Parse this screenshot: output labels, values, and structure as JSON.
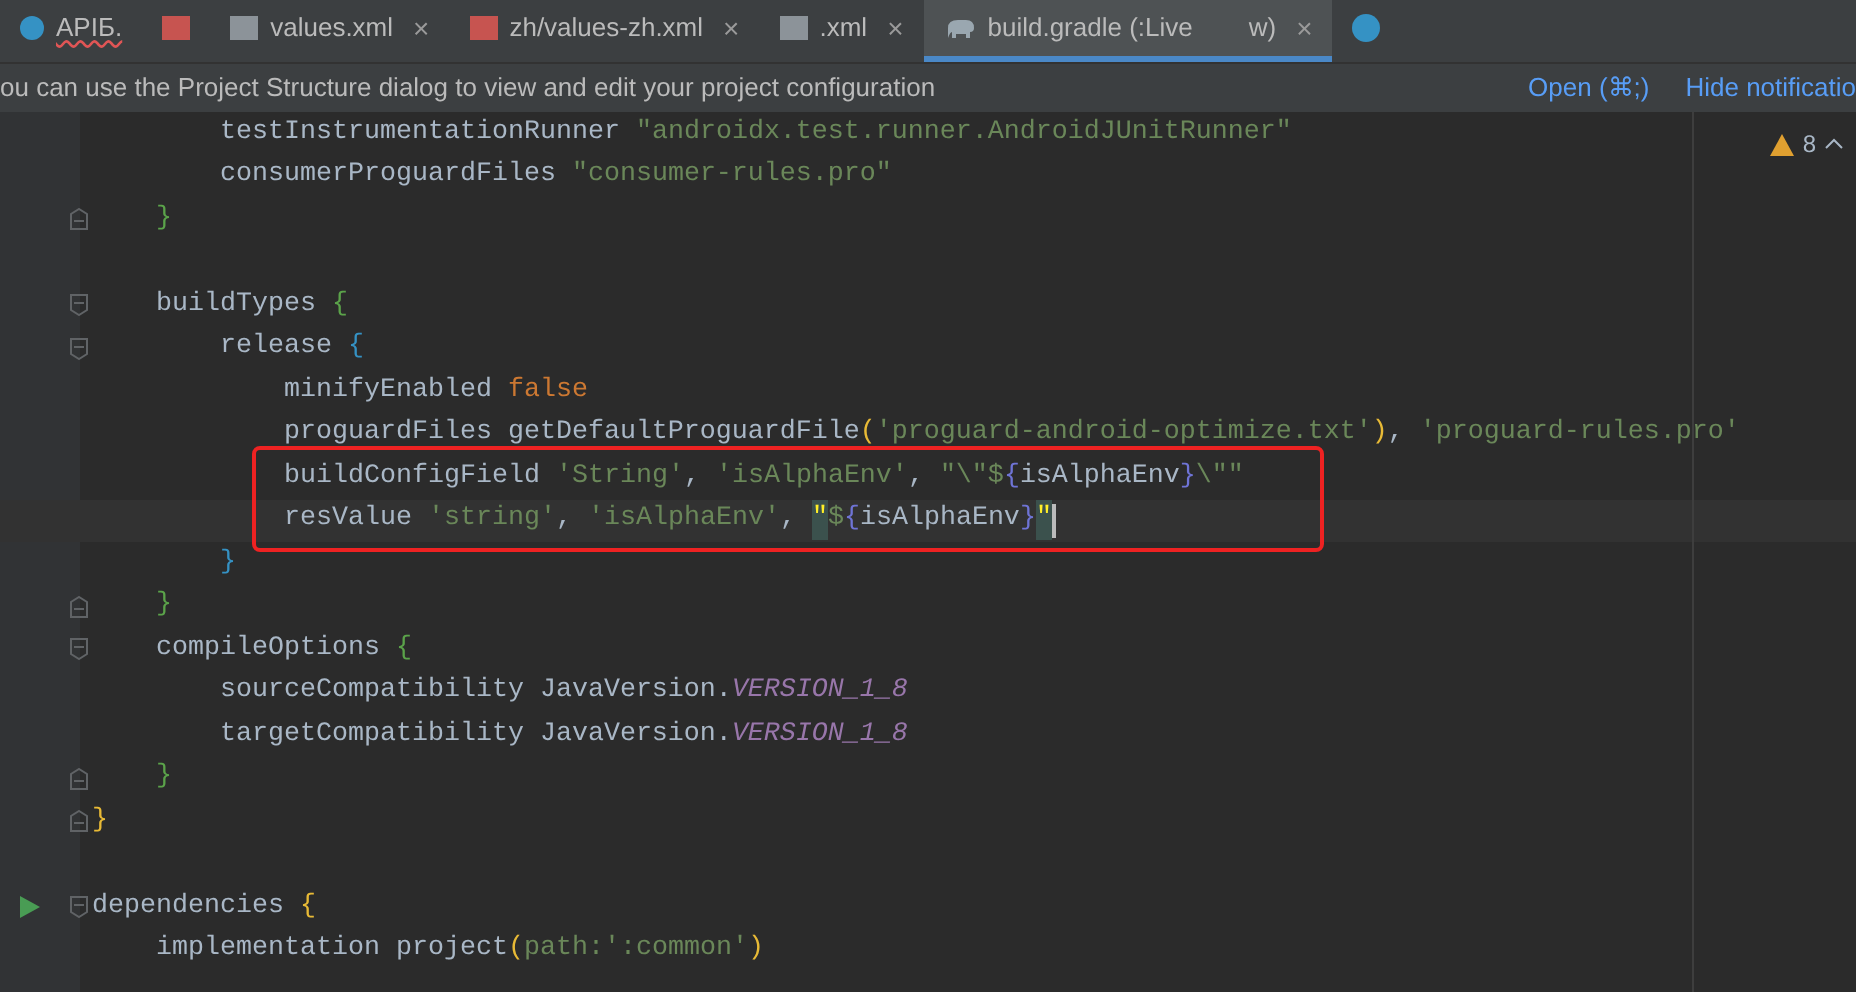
{
  "tabs": [
    {
      "kind": "circle",
      "label": "APIБ.",
      "selected": false,
      "error": true
    },
    {
      "kind": "code",
      "selected": false
    },
    {
      "kind": "xml",
      "label": "values.xml",
      "close": "×",
      "selected": false,
      "error": false
    },
    {
      "kind": "code",
      "label": "zh/values-zh.xml",
      "close": "×",
      "selected": false,
      "error": false
    },
    {
      "kind": "xml",
      "label": ".xml",
      "close": "×",
      "selected": false,
      "error": false
    },
    {
      "kind": "gradle",
      "label": "build.gradle (:Live",
      "label_end": "w)",
      "close": "×",
      "selected": true,
      "error": false
    },
    {
      "kind": "class",
      "selected": false
    }
  ],
  "notification": {
    "message": "ou can use the Project Structure dialog to view and edit your project configuration",
    "actions": [
      "Open (⌘;)",
      "Hide notificatio"
    ]
  },
  "inspections": {
    "warnings": "8"
  },
  "lines": [
    {
      "current": false,
      "tokens": [
        {
          "kind": "plain",
          "text": "        testInstrumentationRunner "
        },
        {
          "kind": "string",
          "text": "\"androidx.test.runner.AndroidJUnitRunner\""
        }
      ]
    },
    {
      "current": false,
      "tokens": [
        {
          "kind": "plain",
          "text": "        consumerProguardFiles "
        },
        {
          "kind": "string",
          "text": "\"consumer-rules.pro\""
        }
      ]
    },
    {
      "kind": "fold_end",
      "current": false,
      "tokens": [
        {
          "kind": "brace_green",
          "text": "    }"
        }
      ]
    },
    {
      "kind": "blank"
    },
    {
      "kind": "fold_start",
      "current": false,
      "tokens": [
        {
          "kind": "plain",
          "text": "    buildTypes "
        },
        {
          "kind": "brace_green",
          "text": "{"
        }
      ]
    },
    {
      "kind": "fold_start",
      "current": false,
      "tokens": [
        {
          "kind": "plain",
          "text": "        release "
        },
        {
          "kind": "brace_blue",
          "text": "{"
        }
      ]
    },
    {
      "current": false,
      "tokens": [
        {
          "kind": "plain",
          "text": "            minifyEnabled "
        },
        {
          "kind": "keyword",
          "text": "false"
        }
      ]
    },
    {
      "current": false,
      "tokens": [
        {
          "kind": "plain",
          "text": "            proguardFiles getDefaultProguardFile"
        },
        {
          "kind": "brace_yellow",
          "text": "("
        },
        {
          "kind": "string",
          "text": "'proguard-android-optimize.txt'"
        },
        {
          "kind": "brace_yellow",
          "text": ")"
        },
        {
          "kind": "plain",
          "text": ", "
        },
        {
          "kind": "string",
          "text": "'proguard-rules.pro'"
        }
      ]
    }
  ],
  "highlight_box": {
    "lines": [
      {
        "current": false,
        "tokens": [
          {
            "kind": "plain",
            "text": "            buildConfigField "
          },
          {
            "kind": "string",
            "text": "'String'"
          },
          {
            "kind": "plain",
            "text": ", "
          },
          {
            "kind": "string",
            "text": "'isAlphaEnv'"
          },
          {
            "kind": "plain",
            "text": ", "
          },
          {
            "kind": "string",
            "text": "\"\\\"$"
          },
          {
            "kind": "brace_purple",
            "text": "{"
          },
          {
            "kind": "plain",
            "text": "isAlphaEnv"
          },
          {
            "kind": "brace_purple",
            "text": "}"
          },
          {
            "kind": "string",
            "text": "\\\"\""
          }
        ]
      },
      {
        "current": true,
        "tokens": [
          {
            "kind": "plain",
            "text": "            resValue "
          },
          {
            "kind": "string",
            "text": "'string'"
          },
          {
            "kind": "plain",
            "text": ", "
          },
          {
            "kind": "string",
            "text": "'isAlphaEnv'"
          },
          {
            "kind": "plain",
            "text": ", "
          },
          {
            "kind": "matched",
            "text": "\""
          },
          {
            "kind": "string",
            "text": "$"
          },
          {
            "kind": "brace_purple",
            "text": "{"
          },
          {
            "kind": "plain",
            "text": "isAlphaEnv"
          },
          {
            "kind": "brace_purple",
            "text": "}"
          },
          {
            "kind": "matched",
            "text": "\""
          }
        ]
      }
    ]
  },
  "lines_after": [
    {
      "current": false,
      "tokens": [
        {
          "kind": "brace_blue",
          "text": "        }"
        }
      ]
    },
    {
      "kind": "fold_end",
      "current": false,
      "tokens": [
        {
          "kind": "brace_green",
          "text": "    }"
        }
      ]
    },
    {
      "kind": "fold_start",
      "current": false,
      "tokens": [
        {
          "kind": "plain",
          "text": "    compileOptions "
        },
        {
          "kind": "brace_green",
          "text": "{"
        }
      ]
    },
    {
      "current": false,
      "tokens": [
        {
          "kind": "plain",
          "text": "        sourceCompatibility JavaVersion."
        },
        {
          "kind": "constant",
          "text": "VERSION_1_8"
        }
      ]
    },
    {
      "current": false,
      "tokens": [
        {
          "kind": "plain",
          "text": "        targetCompatibility JavaVersion."
        },
        {
          "kind": "constant",
          "text": "VERSION_1_8"
        }
      ]
    },
    {
      "kind": "fold_end",
      "current": false,
      "tokens": [
        {
          "kind": "brace_green",
          "text": "    }"
        }
      ]
    },
    {
      "kind": "fold_end",
      "current": false,
      "tokens": [
        {
          "kind": "brace_yellow",
          "text": "}"
        }
      ]
    },
    {
      "kind": "blank"
    },
    {
      "kind": "run_fold",
      "current": false,
      "tokens": [
        {
          "kind": "plain",
          "text": "dependencies "
        },
        {
          "kind": "brace_yellow",
          "text": "{"
        }
      ]
    },
    {
      "current": false,
      "tokens": [
        {
          "kind": "plain",
          "text": "    implementation project"
        },
        {
          "kind": "brace_yellow",
          "text": "("
        },
        {
          "kind": "string",
          "text": "path:"
        },
        {
          "kind": "string",
          "text": "':common'"
        },
        {
          "kind": "brace_yellow",
          "text": ")"
        }
      ]
    }
  ]
}
